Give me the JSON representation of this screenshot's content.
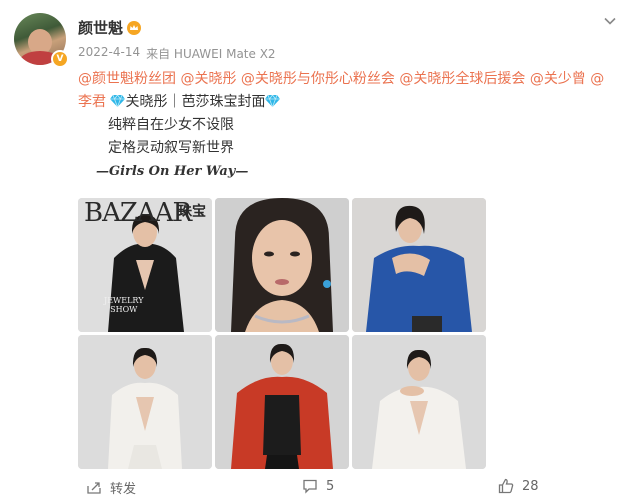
{
  "user": {
    "name": "颜世魁",
    "badge": "V"
  },
  "meta": {
    "date": "2022-4-14",
    "source": "来自 HUAWEI Mate X2"
  },
  "post": {
    "mentions": [
      "@颜世魁粉丝团",
      "@关晓彤",
      "@关晓彤与你彤心粉丝会",
      "@关晓彤全球后援会",
      "@关少曾",
      "@李君"
    ],
    "headline": "关晓彤｜芭莎珠宝封面",
    "line1": "纯粹自在少女不设限",
    "line2": "定格灵动叙写新世界",
    "signature": "—Girls On Her Way—"
  },
  "cover": {
    "masthead": "BAZAAR",
    "masthead_cn": "珠宝",
    "sub1": "JEWELRY",
    "sub2": "SHOW"
  },
  "actions": {
    "repost_label": "转发",
    "comment_count": "5",
    "like_count": "28"
  },
  "colors": {
    "mention": "#eb7350",
    "gem": "#2fb7e8"
  },
  "icons": [
    "chevron-down-icon",
    "crown-icon",
    "gem-icon",
    "repost-icon",
    "comment-icon",
    "like-icon"
  ]
}
